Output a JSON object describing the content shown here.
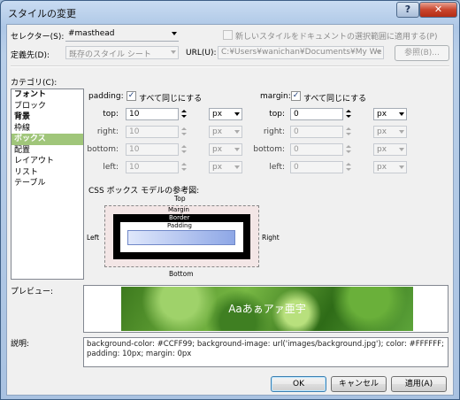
{
  "window": {
    "title": "スタイルの変更",
    "help_label": "?",
    "close_label": "✕"
  },
  "selector": {
    "label": "セレクター(S):",
    "value": "#masthead",
    "apply_checkbox_label": "新しいスタイルをドキュメントの選択範囲に適用する(P)",
    "apply_checked": false
  },
  "define": {
    "label": "定義先(D):",
    "value": "既存のスタイル シート",
    "url_label": "URL(U):",
    "url_value": "C:¥Users¥wanichan¥Documents¥My We",
    "browse_label": "参照(B)..."
  },
  "categories": {
    "label": "カテゴリ(C):",
    "items": [
      {
        "label": "フォント",
        "bold": true,
        "selected": false
      },
      {
        "label": "ブロック",
        "bold": false,
        "selected": false
      },
      {
        "label": "背景",
        "bold": true,
        "selected": false
      },
      {
        "label": "枠線",
        "bold": false,
        "selected": false
      },
      {
        "label": "ボックス",
        "bold": true,
        "selected": true
      },
      {
        "label": "配置",
        "bold": false,
        "selected": false
      },
      {
        "label": "レイアウト",
        "bold": false,
        "selected": false
      },
      {
        "label": "リスト",
        "bold": false,
        "selected": false
      },
      {
        "label": "テーブル",
        "bold": false,
        "selected": false
      }
    ]
  },
  "padding": {
    "label": "padding:",
    "same_label": "すべて同じにする",
    "same_checked": true,
    "rows": [
      {
        "side": "top:",
        "value": "10",
        "unit": "px",
        "enabled": true
      },
      {
        "side": "right:",
        "value": "10",
        "unit": "px",
        "enabled": false
      },
      {
        "side": "bottom:",
        "value": "10",
        "unit": "px",
        "enabled": false
      },
      {
        "side": "left:",
        "value": "10",
        "unit": "px",
        "enabled": false
      }
    ]
  },
  "margin": {
    "label": "margin:",
    "same_label": "すべて同じにする",
    "same_checked": true,
    "rows": [
      {
        "side": "top:",
        "value": "0",
        "unit": "px",
        "enabled": true
      },
      {
        "side": "right:",
        "value": "0",
        "unit": "px",
        "enabled": false
      },
      {
        "side": "bottom:",
        "value": "0",
        "unit": "px",
        "enabled": false
      },
      {
        "side": "left:",
        "value": "0",
        "unit": "px",
        "enabled": false
      }
    ]
  },
  "box_model": {
    "heading": "CSS ボックス モデルの参考図:",
    "top": "Top",
    "bottom": "Bottom",
    "left": "Left",
    "right": "Right",
    "margin": "Margin",
    "border": "Border",
    "padding": "Padding"
  },
  "preview": {
    "label": "プレビュー:",
    "sample_text": "Aaあぁアァ亜宇"
  },
  "description": {
    "label": "説明:",
    "text": "background-color: #CCFF99; background-image: url('images/background.jpg'); color: #FFFFFF; padding: 10px; margin: 0px"
  },
  "buttons": {
    "ok": "OK",
    "cancel": "キャンセル",
    "apply": "適用(A)"
  },
  "colors": {
    "selected_category": "#a0c67a",
    "preview_text": "#FFFFFF"
  }
}
